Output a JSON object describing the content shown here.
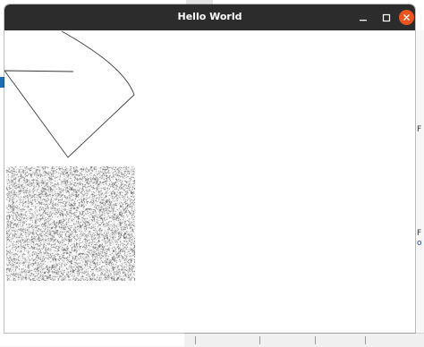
{
  "window": {
    "title": "Hello World"
  },
  "controls": {
    "minimize_icon": "minimize-icon",
    "maximize_icon": "maximize-icon",
    "close_icon": "close-icon"
  },
  "background": {
    "right_edge_chars": [
      "F",
      "F",
      "o"
    ]
  },
  "colors": {
    "titlebar": "#2c2c2c",
    "title_text": "#ffffff",
    "close_button": "#e95420",
    "canvas": "#ffffff",
    "stroke": "#3a3a3a",
    "noise_dots": "#555555"
  }
}
